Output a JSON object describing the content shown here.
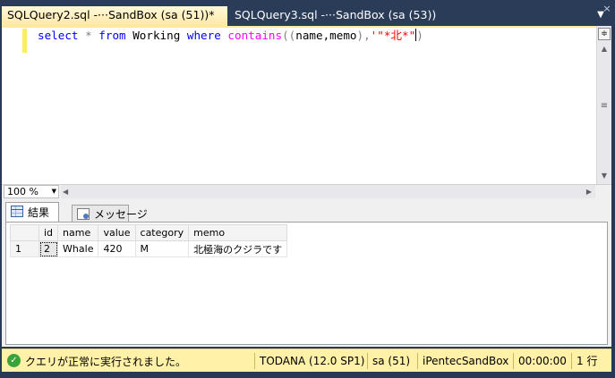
{
  "tabs": [
    {
      "label": "SQLQuery2.sql -···SandBox (sa (51))*",
      "active": true
    },
    {
      "label": "SQLQuery3.sql -···SandBox (sa (53))",
      "active": false
    }
  ],
  "editor": {
    "code": {
      "select": "select",
      "star": "*",
      "from": "from",
      "table": "Working",
      "where": "where",
      "contains": "contains",
      "open_paren": "((",
      "cols": "name,memo",
      "close_comma": "),",
      "literal": "'\"*北*\"",
      "end": ")"
    }
  },
  "zoom": {
    "value": "100 %"
  },
  "results": {
    "tabs": [
      {
        "label": "結果",
        "icon": "grid-icon"
      },
      {
        "label": "メッセージ",
        "icon": "message-icon"
      }
    ],
    "columns": [
      "id",
      "name",
      "value",
      "category",
      "memo"
    ],
    "rows": [
      {
        "rownum": "1",
        "cells": [
          "2",
          "Whale",
          "420",
          "M",
          "北極海のクジラです"
        ]
      }
    ]
  },
  "status": {
    "message": "クエリが正常に実行されました。",
    "server": "TODANA (12.0 SP1)",
    "user": "sa (51)",
    "database": "iPentecSandBox",
    "elapsed": "00:00:00",
    "rows": "1 行"
  },
  "colors": {
    "window_bg": "#293955",
    "active_tab": "#ffe8a6",
    "status_bg": "#fff1a8",
    "keyword": "#0000ff",
    "function": "#ff00ff",
    "string": "#ff0000"
  }
}
